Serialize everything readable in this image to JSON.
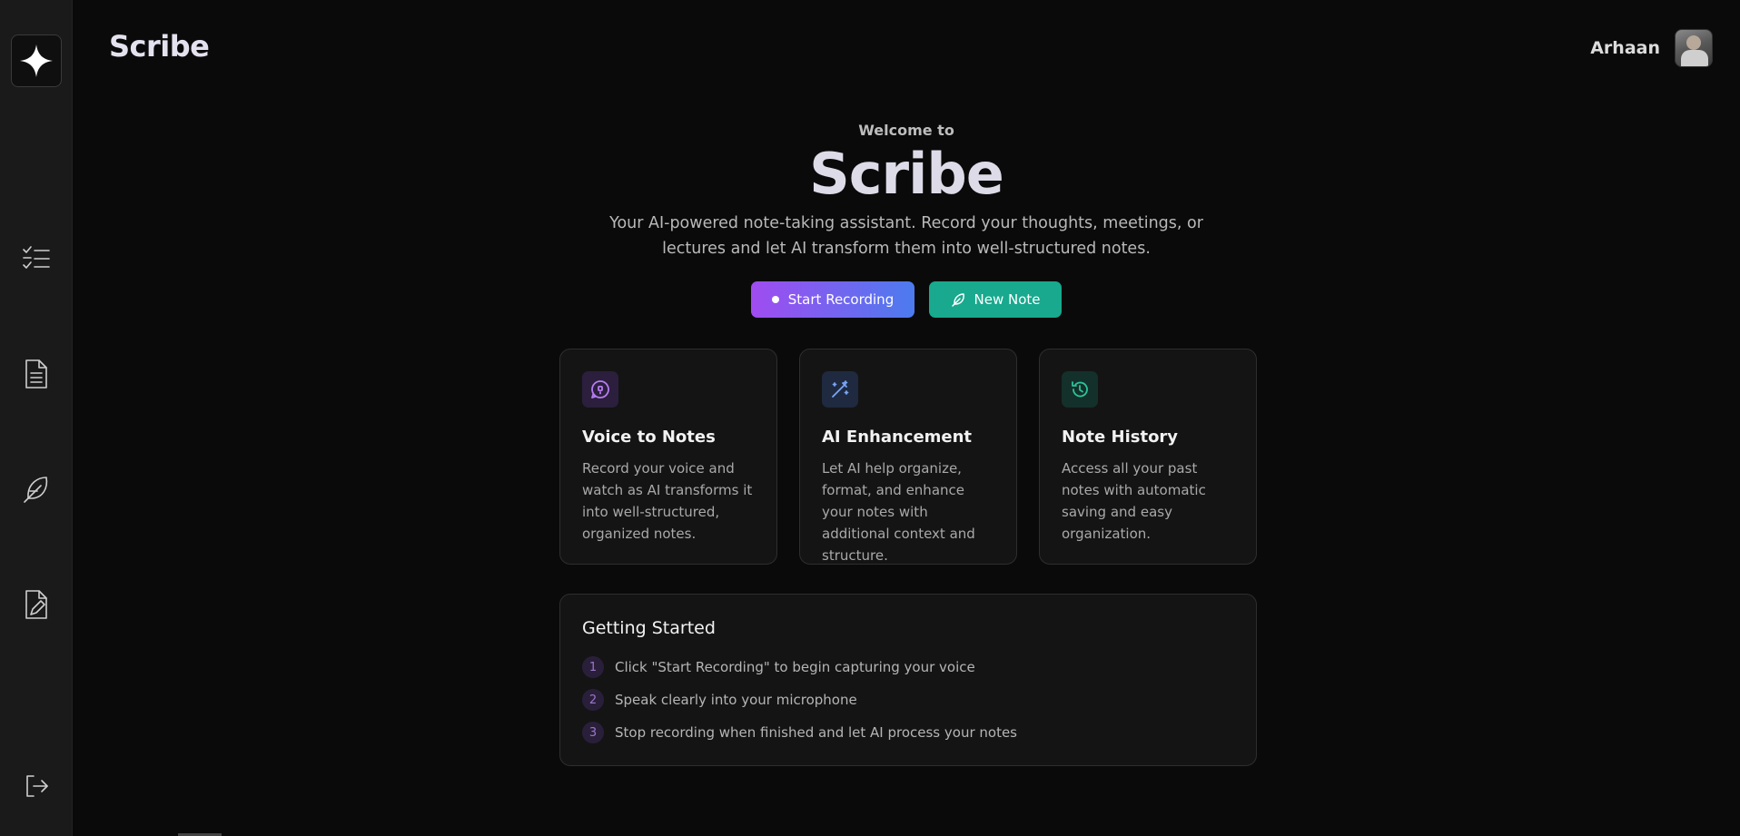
{
  "app": {
    "brand": "Scribe"
  },
  "user": {
    "name": "Arhaan"
  },
  "sidebar": {
    "items": [
      {
        "icon": "checklist-icon"
      },
      {
        "icon": "document-icon"
      },
      {
        "icon": "feather-icon"
      },
      {
        "icon": "edit-file-icon"
      }
    ],
    "logout_icon": "logout-icon"
  },
  "hero": {
    "welcome": "Welcome to",
    "title": "Scribe",
    "description": "Your AI-powered note-taking assistant. Record your thoughts, meetings, or lectures and let AI transform them into well-structured notes.",
    "start_recording_label": "Start Recording",
    "new_note_label": "New Note"
  },
  "features": [
    {
      "icon": "voice-chat-icon",
      "title": "Voice to Notes",
      "description": "Record your voice and watch as AI transforms it into well-structured, organized notes.",
      "accent": "#a66ae8"
    },
    {
      "icon": "magic-wand-icon",
      "title": "AI Enhancement",
      "description": "Let AI help organize, format, and enhance your notes with additional context and structure.",
      "accent": "#6b9cf5"
    },
    {
      "icon": "history-icon",
      "title": "Note History",
      "description": "Access all your past notes with automatic saving and easy organization.",
      "accent": "#2cc39a"
    }
  ],
  "getting_started": {
    "title": "Getting Started",
    "steps": [
      {
        "num": "1",
        "text": "Click \"Start Recording\" to begin capturing your voice"
      },
      {
        "num": "2",
        "text": "Speak clearly into your microphone"
      },
      {
        "num": "3",
        "text": "Stop recording when finished and let AI process your notes"
      }
    ]
  },
  "colors": {
    "background": "#0a0a0a",
    "sidebar": "#1a1a1a",
    "record_gradient_start": "#a04cf0",
    "record_gradient_end": "#4c7bef",
    "new_note": "#18a98e"
  }
}
